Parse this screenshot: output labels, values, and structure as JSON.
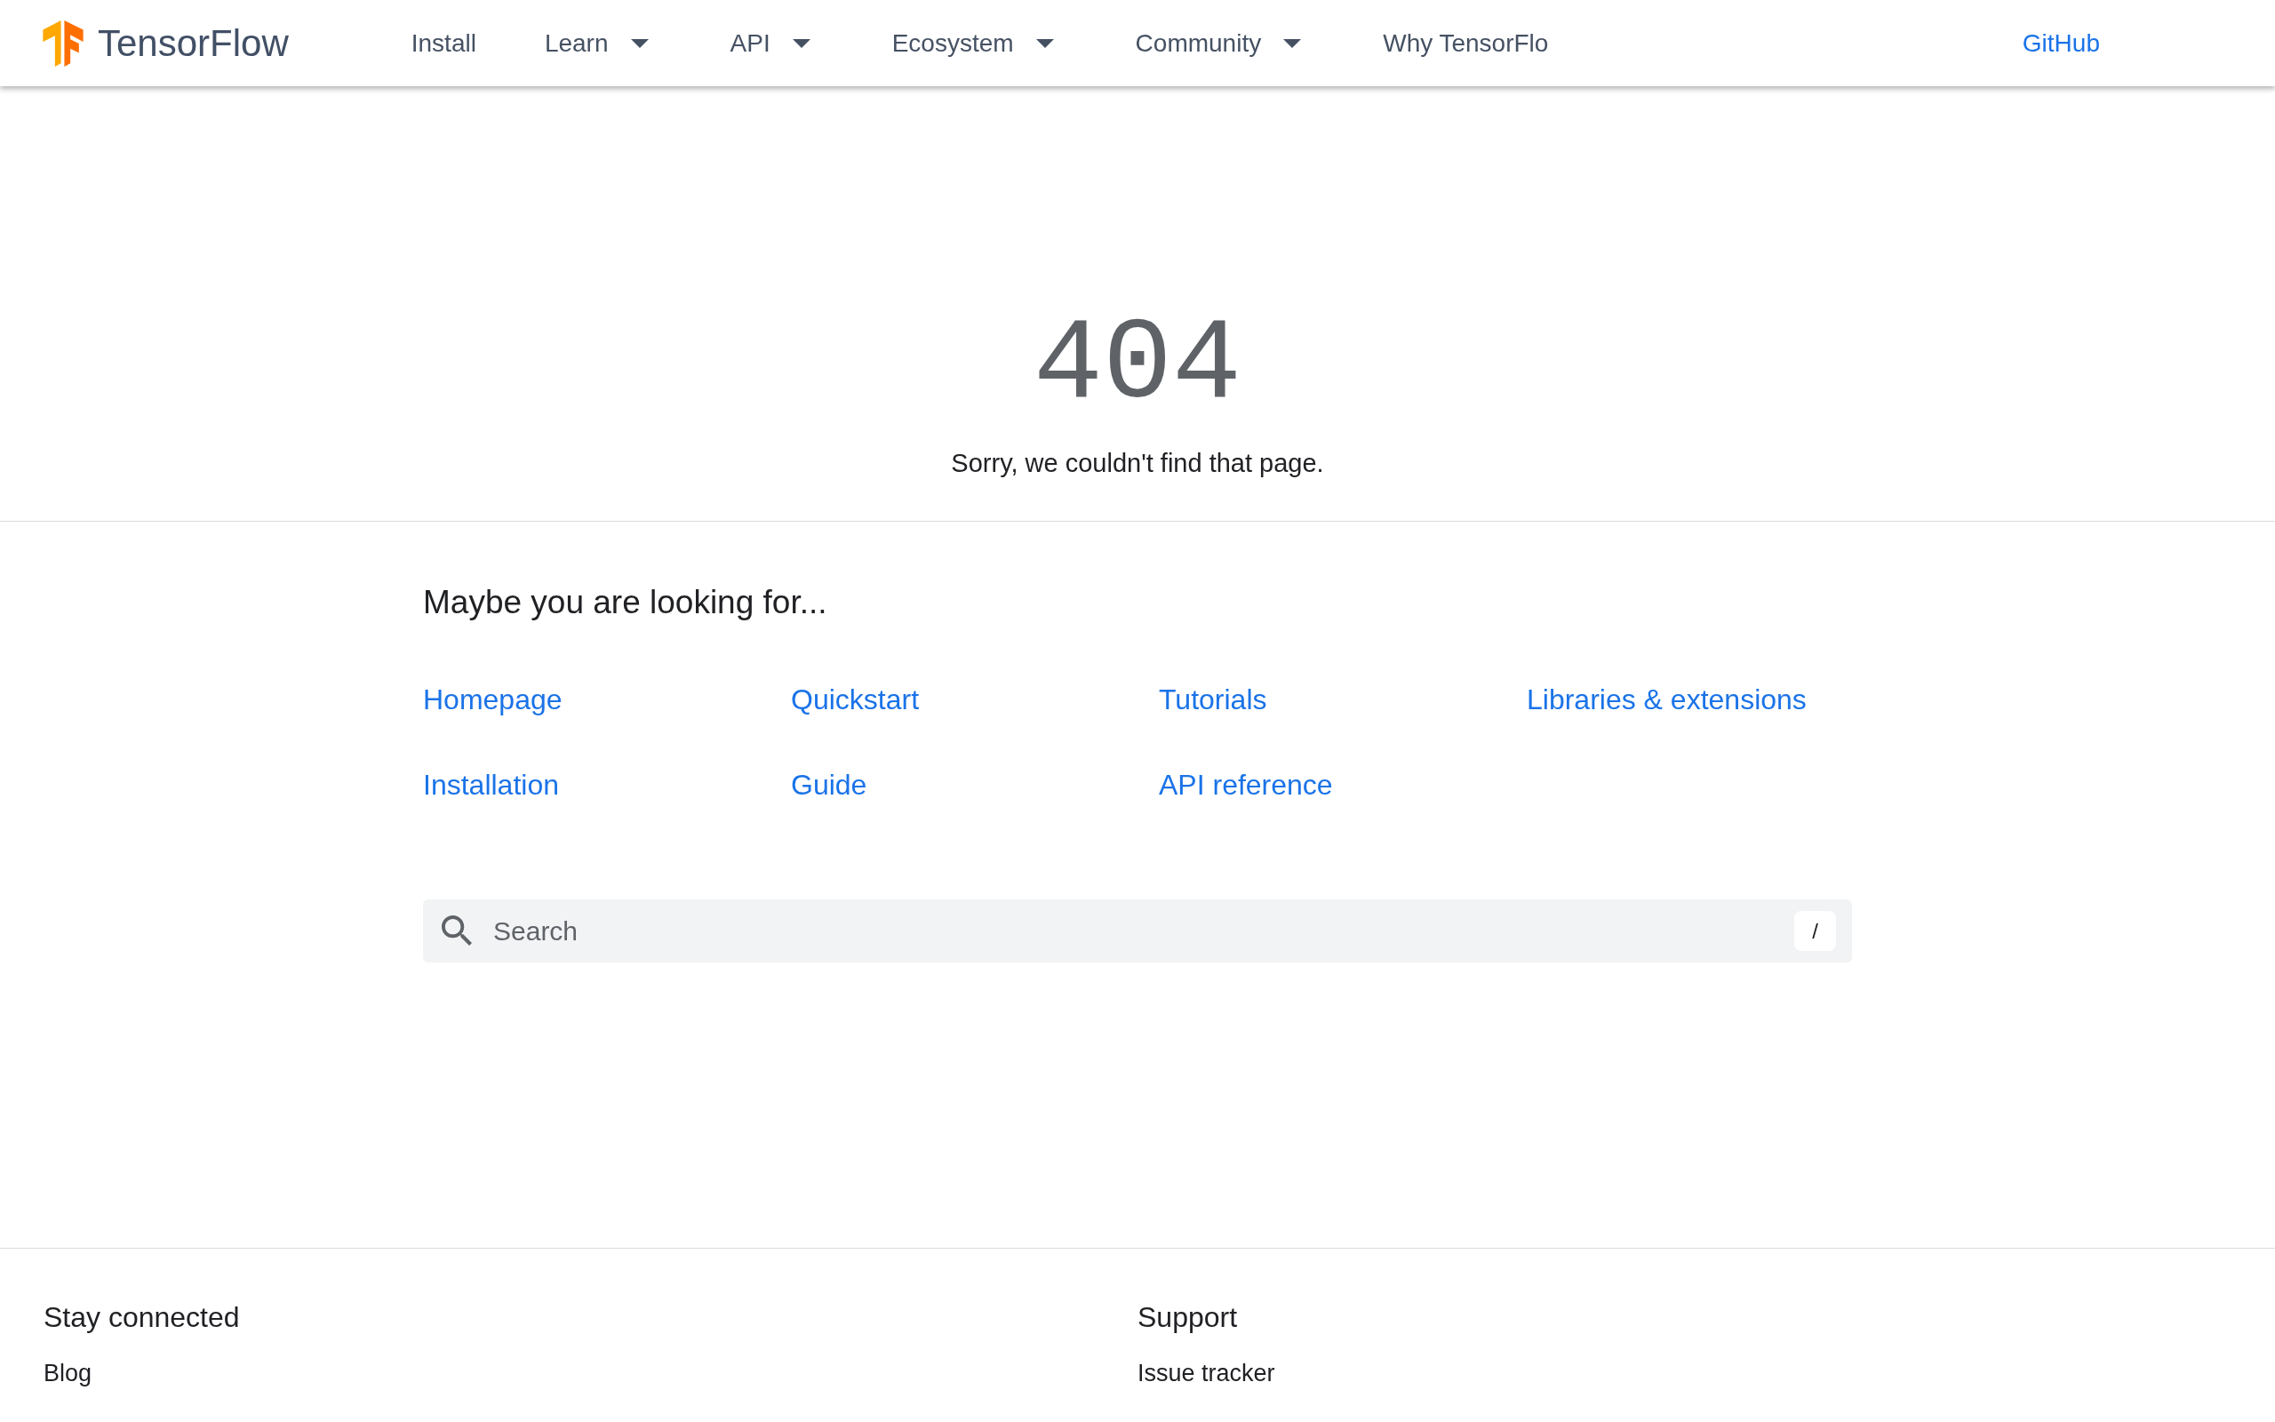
{
  "header": {
    "logo_text": "TensorFlow",
    "nav": [
      {
        "label": "Install",
        "kind": "link"
      },
      {
        "label": "Learn",
        "kind": "dropdown"
      },
      {
        "label": "API",
        "kind": "dropdown"
      },
      {
        "label": "Ecosystem",
        "kind": "dropdown"
      },
      {
        "label": "Community",
        "kind": "dropdown"
      },
      {
        "label": "Why TensorFlo",
        "kind": "link"
      }
    ],
    "github_link": "GitHub"
  },
  "error": {
    "code": "404",
    "message": "Sorry, we couldn't find that page."
  },
  "suggestions": {
    "heading": "Maybe you are looking for...",
    "links": [
      "Homepage",
      "Quickstart",
      "Tutorials",
      "Libraries & extensions",
      "Installation",
      "Guide",
      "API reference"
    ]
  },
  "search": {
    "placeholder": "Search",
    "shortcut": "/"
  },
  "footer": {
    "columns": [
      {
        "heading": "Stay connected",
        "links": [
          "Blog"
        ]
      },
      {
        "heading": "Support",
        "links": [
          "Issue tracker"
        ]
      }
    ]
  }
}
